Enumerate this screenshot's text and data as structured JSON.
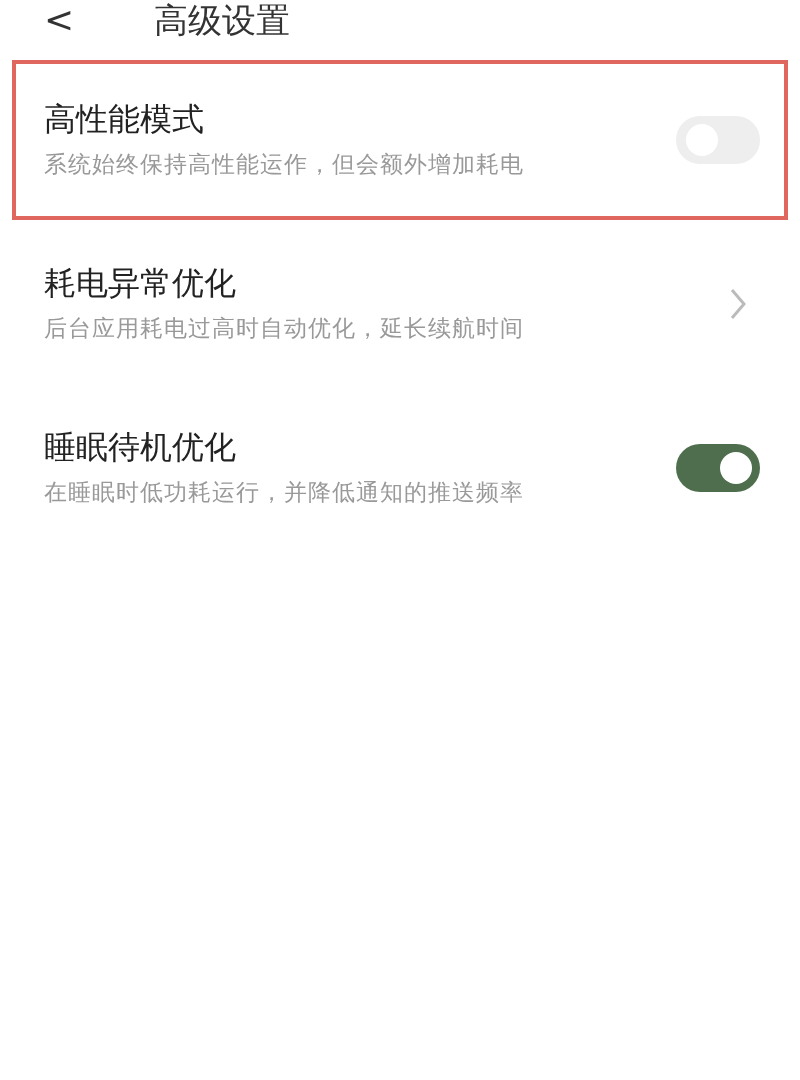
{
  "header": {
    "back": "<",
    "title": "高级设置"
  },
  "settings": [
    {
      "kind": "toggle",
      "title": "高性能模式",
      "subtitle": "系统始终保持高性能运作，但会额外增加耗电",
      "on": false,
      "highlighted": true
    },
    {
      "kind": "link",
      "title": "耗电异常优化",
      "subtitle": "后台应用耗电过高时自动优化，延长续航时间",
      "highlighted": false
    },
    {
      "kind": "toggle",
      "title": "睡眠待机优化",
      "subtitle": "在睡眠时低功耗运行，并降低通知的推送频率",
      "on": true,
      "highlighted": false
    }
  ]
}
